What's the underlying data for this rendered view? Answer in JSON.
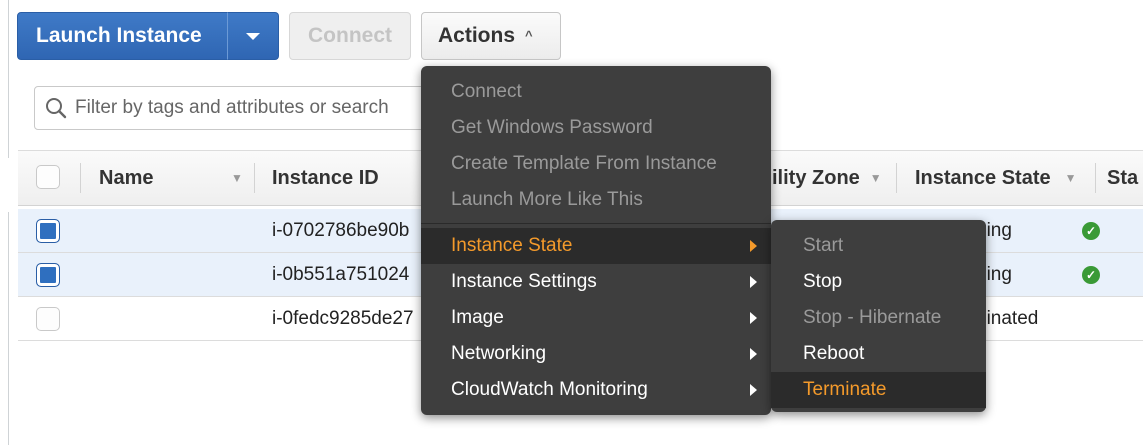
{
  "toolbar": {
    "launch_label": "Launch Instance",
    "connect_label": "Connect",
    "actions_label": "Actions",
    "actions_caret": "^"
  },
  "search": {
    "placeholder": "Filter by tags and attributes or search"
  },
  "table": {
    "columns": [
      "Name",
      "Instance ID",
      "ility Zone",
      "Instance State",
      "Sta"
    ],
    "rows": [
      {
        "selected": true,
        "instance_id": "i-0702786be90b",
        "state": "hing",
        "status_ok": true
      },
      {
        "selected": true,
        "instance_id": "i-0b551a751024",
        "state": "hing",
        "status_ok": true
      },
      {
        "selected": false,
        "instance_id": "i-0fedc9285de27",
        "state": "hinated",
        "status_ok": false
      }
    ]
  },
  "actions_menu": {
    "items": [
      {
        "label": "Connect",
        "state": "disabled"
      },
      {
        "label": "Get Windows Password",
        "state": "disabled"
      },
      {
        "label": "Create Template From Instance",
        "state": "disabled"
      },
      {
        "label": "Launch More Like This",
        "state": "disabled"
      },
      {
        "label": "Instance State",
        "state": "active",
        "submenu": true
      },
      {
        "label": "Instance Settings",
        "state": "enabled",
        "submenu": true
      },
      {
        "label": "Image",
        "state": "enabled",
        "submenu": true
      },
      {
        "label": "Networking",
        "state": "enabled",
        "submenu": true
      },
      {
        "label": "CloudWatch Monitoring",
        "state": "enabled",
        "submenu": true
      }
    ]
  },
  "instance_state_menu": {
    "items": [
      {
        "label": "Start",
        "state": "disabled"
      },
      {
        "label": "Stop",
        "state": "enabled"
      },
      {
        "label": "Stop - Hibernate",
        "state": "disabled"
      },
      {
        "label": "Reboot",
        "state": "enabled"
      },
      {
        "label": "Terminate",
        "state": "active"
      }
    ]
  },
  "colors": {
    "primary_button": "#2f66b3",
    "menu_bg": "#3e3e3e",
    "menu_highlight": "#f49a2b",
    "status_ok": "#3a9a36"
  },
  "icons": [
    "search-icon",
    "caret-down-icon",
    "caret-up-icon",
    "sort-icon",
    "submenu-arrow-icon",
    "status-ok-icon"
  ]
}
